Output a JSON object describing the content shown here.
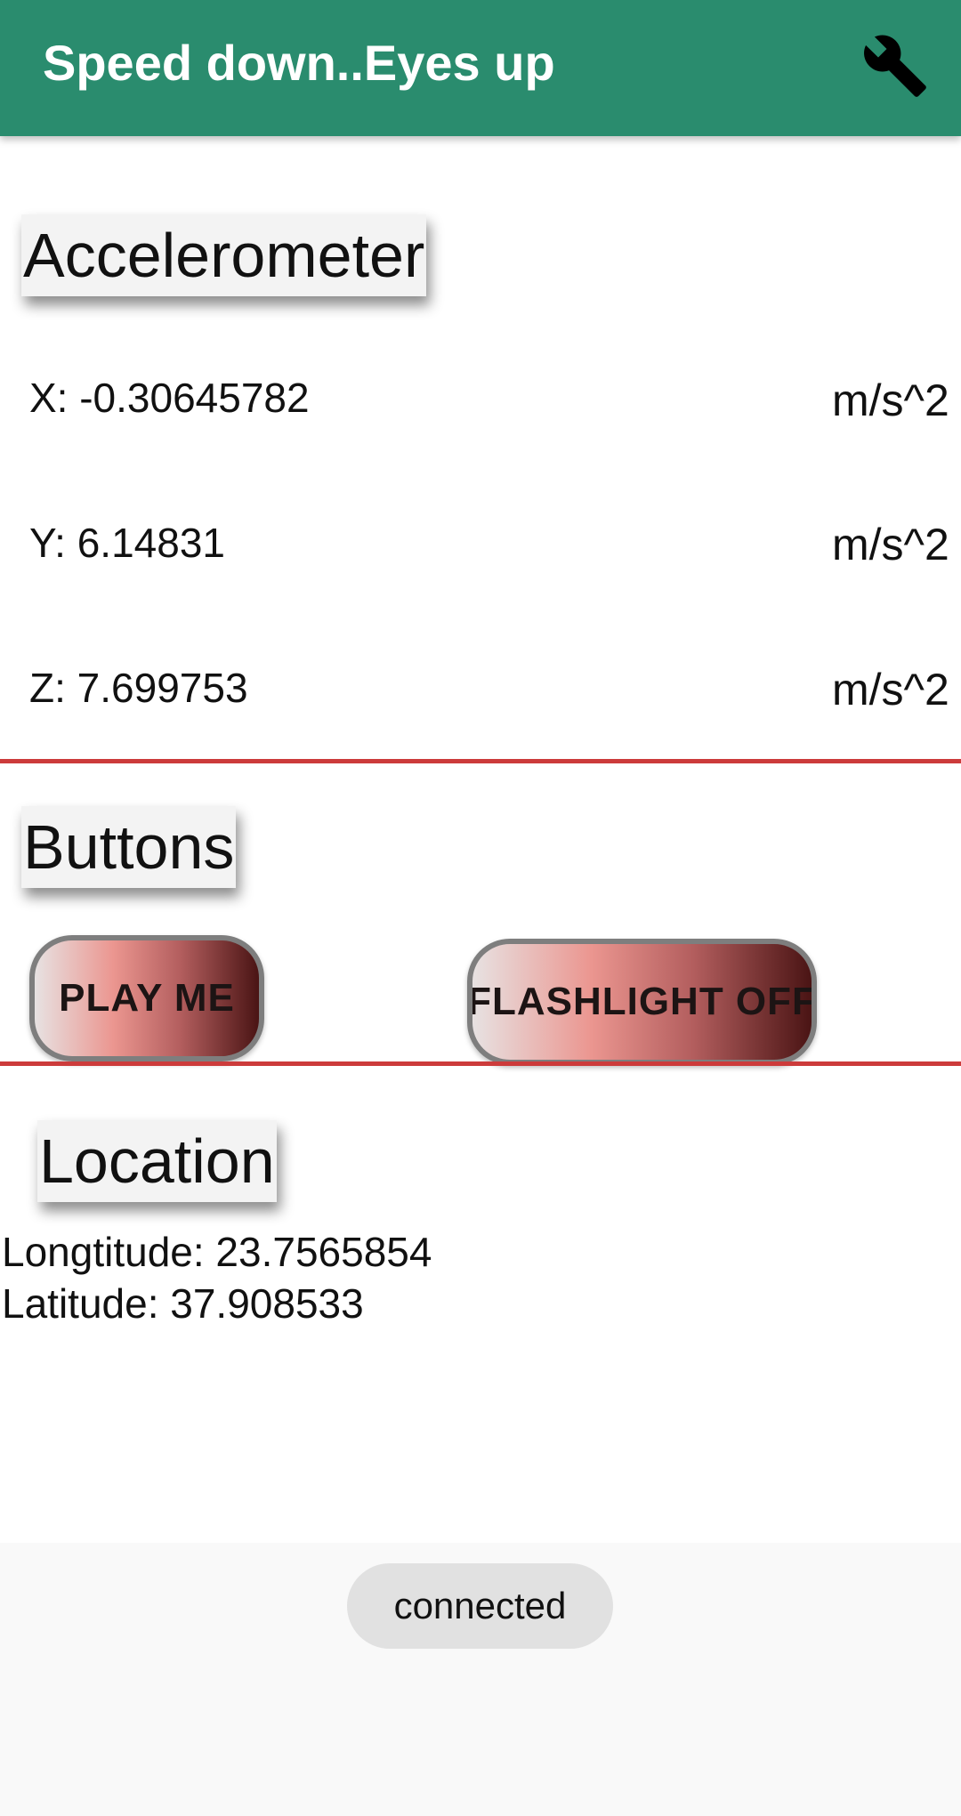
{
  "theme": {
    "brand": "#2a8c6e",
    "divider": "#cc3b3b"
  },
  "app_bar": {
    "title": "Speed down..Eyes up",
    "settings_icon": "wrench-icon"
  },
  "accelerometer": {
    "heading": "Accelerometer",
    "rows": [
      {
        "label": "X: -0.30645782",
        "unit": "m/s^2"
      },
      {
        "label": "Y: 6.14831",
        "unit": "m/s^2"
      },
      {
        "label": "Z: 7.699753",
        "unit": "m/s^2"
      }
    ]
  },
  "buttons": {
    "heading": "Buttons",
    "play_label": "PLAY ME",
    "flashlight_label": "FLASHLIGHT OFF"
  },
  "location": {
    "heading": "Location",
    "longitude": "Longtitude: 23.7565854",
    "latitude": "Latitude: 37.908533"
  },
  "toast": {
    "text": "connected"
  }
}
